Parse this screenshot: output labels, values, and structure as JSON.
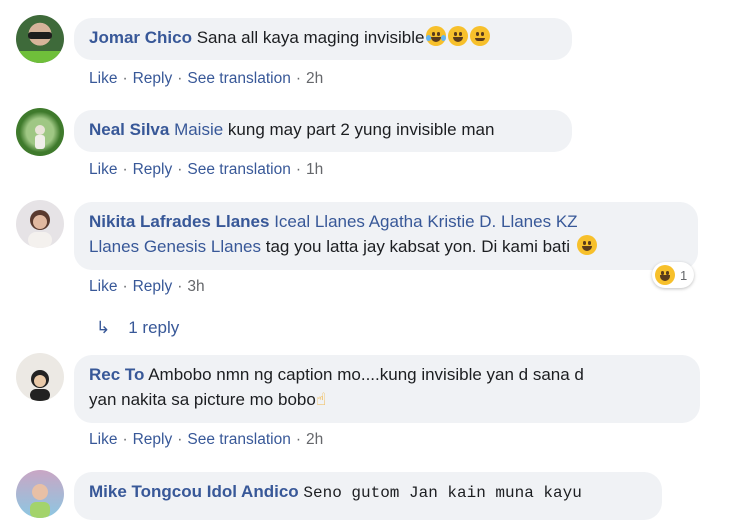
{
  "comments": [
    {
      "author": "Jomar Chico",
      "text": "Sana all kaya maging invisible",
      "emojis": [
        "laugh-tears-emoji",
        "grin-emoji",
        "smile-emoji"
      ],
      "actions": {
        "like": "Like",
        "reply": "Reply",
        "translate": "See translation",
        "time": "2h"
      }
    },
    {
      "author": "Neal Silva",
      "mention": "Maisie",
      "text": "kung may part 2 yung invisible man",
      "actions": {
        "like": "Like",
        "reply": "Reply",
        "translate": "See translation",
        "time": "1h"
      }
    },
    {
      "author": "Nikita Lafrades Llanes",
      "mention_line1": "Iceal Llanes Agatha Kristie D. Llanes KZ",
      "mention_line2": "Llanes Genesis Llanes",
      "text": "tag you latta jay kabsat yon. Di kami bati",
      "emojis": [
        "grin-sweat-emoji"
      ],
      "reaction_count": "1",
      "actions": {
        "like": "Like",
        "reply": "Reply",
        "time": "3h"
      },
      "replies_link": "1 reply"
    },
    {
      "author": "Rec To",
      "text_line1": "Ambobo nmn ng caption mo....kung invisible yan d sana d",
      "text_line2": "yan nakita sa picture mo bobo",
      "emojis": [
        "pointing-finger-emoji"
      ],
      "actions": {
        "like": "Like",
        "reply": "Reply",
        "translate": "See translation",
        "time": "2h"
      }
    },
    {
      "author": "Mike Tongcou Idol Andico",
      "text": "Seno gutom Jan kain muna kayu"
    }
  ],
  "colors": {
    "link": "#385898",
    "bubble": "#f0f2f5",
    "meta": "#65676b"
  }
}
